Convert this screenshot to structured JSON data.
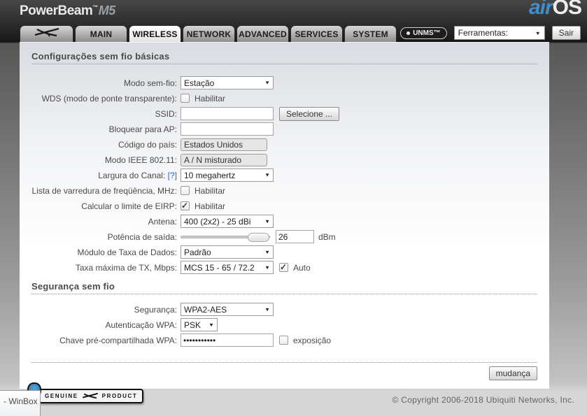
{
  "header": {
    "device_name": "PowerBeam",
    "device_tm": "™",
    "device_model": "M5",
    "brand_air": "air",
    "brand_os": "OS",
    "unms_button": "UNMS™",
    "tools_dropdown": "Ferramentas:",
    "logout_button": "Sair"
  },
  "tabs": {
    "main": "MAIN",
    "wireless": "WIRELESS",
    "network": "NETWORK",
    "advanced": "ADVANCED",
    "services": "SERVICES",
    "system": "SYSTEM"
  },
  "basic": {
    "section_title": "Configurações sem fio básicas",
    "wireless_mode": {
      "label": "Modo sem-fio:",
      "value": "Estação"
    },
    "wds": {
      "label": "WDS (modo de ponte transparente):",
      "option": "Habilitar",
      "checked": false
    },
    "ssid": {
      "label": "SSID:",
      "value": "",
      "button": "Selecione ..."
    },
    "lock_to_ap": {
      "label": "Bloquear para AP:",
      "value": ""
    },
    "country_code": {
      "label": "Código do país:",
      "value": "Estados Unidos"
    },
    "ieee_mode": {
      "label": "Modo IEEE 802.11:",
      "value": "A / N misturado"
    },
    "channel_width": {
      "label": "Largura do Canal:",
      "help": "[?]",
      "value": "10 megahertz"
    },
    "freq_scan_list": {
      "label": "Lista de varredura de freqüência, MHz:",
      "option": "Habilitar",
      "checked": false
    },
    "eirp_limit": {
      "label": "Calcular o limite de EIRP:",
      "option": "Habilitar",
      "checked": true
    },
    "antenna": {
      "label": "Antena:",
      "value": "400 (2x2) - 25 dBi"
    },
    "output_power": {
      "label": "Potência de saída:",
      "value": "26",
      "unit": "dBm"
    },
    "data_rate_module": {
      "label": "Módulo de Taxa de Dados:",
      "value": "Padrão"
    },
    "max_tx_rate": {
      "label": "Taxa máxima de TX, Mbps:",
      "value": "MCS 15 - 65 / 72.2",
      "auto_option": "Auto",
      "auto_checked": true
    }
  },
  "security": {
    "section_title": "Segurança sem fio",
    "security_mode": {
      "label": "Segurança:",
      "value": "WPA2-AES"
    },
    "wpa_auth": {
      "label": "Autenticação WPA:",
      "value": "PSK"
    },
    "wpa_psk": {
      "label": "Chave pré-compartilhada WPA:",
      "value": "•••••••••••",
      "toggle_option": "exposição",
      "toggle_checked": false
    }
  },
  "actions": {
    "change_button": "mudança"
  },
  "footer": {
    "copyright": "© Copyright 2006-2018 Ubiquiti Networks, Inc.",
    "genuine_badge_left": "GENUINE",
    "genuine_badge_right": "PRODUCT",
    "winbox_tooltip": "- WinBox"
  }
}
